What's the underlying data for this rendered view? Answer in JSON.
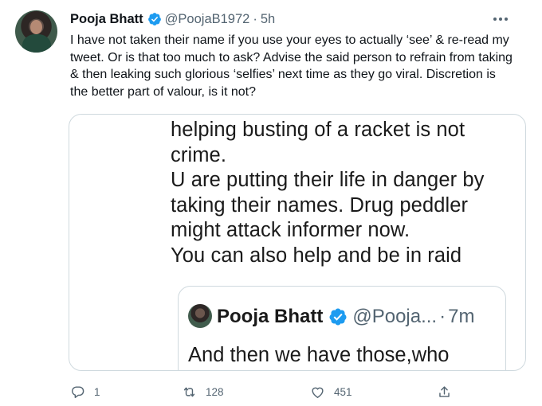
{
  "tweet": {
    "author": {
      "display_name": "Pooja Bhatt",
      "handle": "@PoojaB1972",
      "separator": "·",
      "time": "5h",
      "verified": true
    },
    "text": "I have not taken their name if you use your eyes to actually ‘see’ & re-read my tweet. Or is that too much to ask? Advise the said person to refrain from taking & then leaking such glorious ‘selfies’ next time as they go viral. Discretion is the better part of valour, is it not?",
    "media": {
      "text_lines": [
        "helping busting of a racket is not",
        "crime.",
        "U are putting their life in danger by",
        "taking their names. Drug peddler",
        "might attack informer now.",
        "You can also help and be in raid"
      ],
      "quoted_tweet": {
        "display_name": "Pooja Bhatt",
        "handle": "@Pooja...",
        "separator": "·",
        "time": "7m",
        "text": "And then we have those,who"
      }
    },
    "actions": {
      "reply_count": "1",
      "retweet_count": "128",
      "like_count": "451"
    }
  },
  "icons": {
    "verified": "verified-badge-icon",
    "more": "more-options-icon",
    "reply": "reply-icon",
    "retweet": "retweet-icon",
    "like": "heart-icon",
    "share": "share-icon"
  },
  "colors": {
    "verified_blue": "#1d9bf0",
    "secondary_text": "#536471",
    "border": "#cfd9de",
    "primary_text": "#0f1419"
  }
}
